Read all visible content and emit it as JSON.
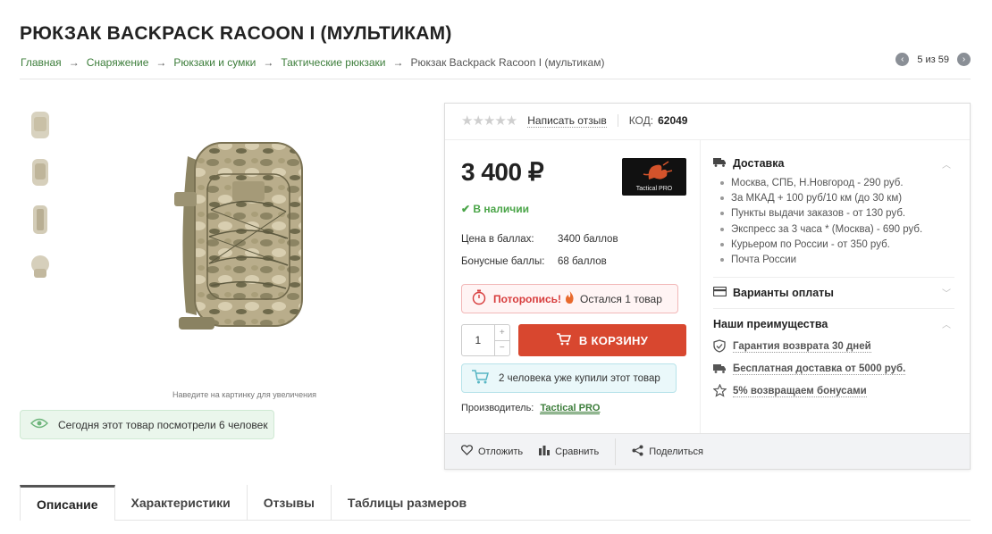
{
  "title": "РЮКЗАК BACKPACK RACOON I (МУЛЬТИКАМ)",
  "breadcrumbs": [
    "Главная",
    "Снаряжение",
    "Рюкзаки и сумки",
    "Тактические рюкзаки",
    "Рюкзак Backpack Racoon I (мультикам)"
  ],
  "breadcrumb_sep": "→",
  "pager": {
    "prev": "‹",
    "text": "5 из 59",
    "next": "›"
  },
  "gallery": {
    "zoom_hint": "Наведите на картинку для увеличения",
    "thumbnails": [
      "thumb-1",
      "thumb-2",
      "thumb-3",
      "thumb-4"
    ]
  },
  "views": "Сегодня этот товар посмотрели 6 человек",
  "card": {
    "stars": "★★★★★",
    "rating": 0,
    "review_link": "Написать отзыв",
    "code_label": "КОД:",
    "code_value": "62049",
    "price": "3 400 ₽",
    "brand_logo_text": "Tactical PRO",
    "in_stock": "✔ В наличии",
    "price_points_label": "Цена в баллах:",
    "price_points_value": "3400 баллов",
    "bonus_label": "Бонусные баллы:",
    "bonus_value": "68 баллов",
    "hurry_bold": "Поторопись!",
    "hurry_text": "Остался 1 товар",
    "quantity": "1",
    "qty_plus": "+",
    "qty_minus": "−",
    "cart_button": "В КОРЗИНУ",
    "bought": "2 человека уже купили этот товар",
    "maker_label": "Производитель:",
    "maker_value": "Tactical PRO"
  },
  "delivery": {
    "title": "Доставка",
    "items": [
      "Москва, СПБ, Н.Новгород - 290 руб.",
      "За МКАД + 100 руб/10 км (до 30 км)",
      "Пункты выдачи заказов - от 130 руб.",
      "Экспресс за 3 часа * (Москва) - 690 руб.",
      "Курьером по России - от 350 руб.",
      "Почта России"
    ]
  },
  "payment": {
    "title": "Варианты оплаты"
  },
  "advantages": {
    "title": "Наши преимущества",
    "items": [
      "Гарантия возврата 30 дней",
      "Бесплатная доставка от 5000 руб.",
      "5% возвращаем бонусами"
    ]
  },
  "actions": {
    "postpone": "Отложить",
    "compare": "Сравнить",
    "share": "Поделиться"
  },
  "tabs": [
    "Описание",
    "Характеристики",
    "Отзывы",
    "Таблицы размеров"
  ],
  "colors": {
    "green": "#3c7d3a",
    "red": "#d8472f",
    "stock": "#4aa548"
  }
}
